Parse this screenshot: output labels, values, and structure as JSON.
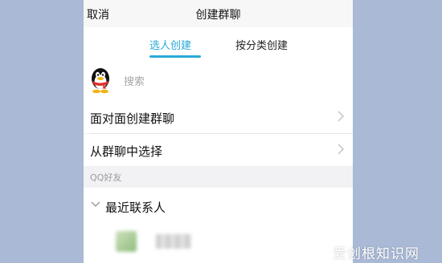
{
  "header": {
    "cancel_label": "取消",
    "title": "创建群聊"
  },
  "tabs": [
    {
      "label": "选人创建",
      "active": true
    },
    {
      "label": "按分类创建",
      "active": false
    }
  ],
  "search": {
    "placeholder": "搜索",
    "icon": "qq-penguin-icon"
  },
  "menu": [
    {
      "label": "面对面创建群聊",
      "icon": "chevron-right-icon"
    },
    {
      "label": "从群聊中选择",
      "icon": "chevron-right-icon"
    }
  ],
  "section": {
    "title": "QQ好友"
  },
  "group": {
    "label": "最近联系人",
    "icon": "chevron-down-icon"
  },
  "watermark": {
    "text": "爱创根知识网"
  },
  "colors": {
    "accent": "#2aa9d6",
    "background": "#a9b9d6",
    "panel": "#f2f2f4"
  }
}
